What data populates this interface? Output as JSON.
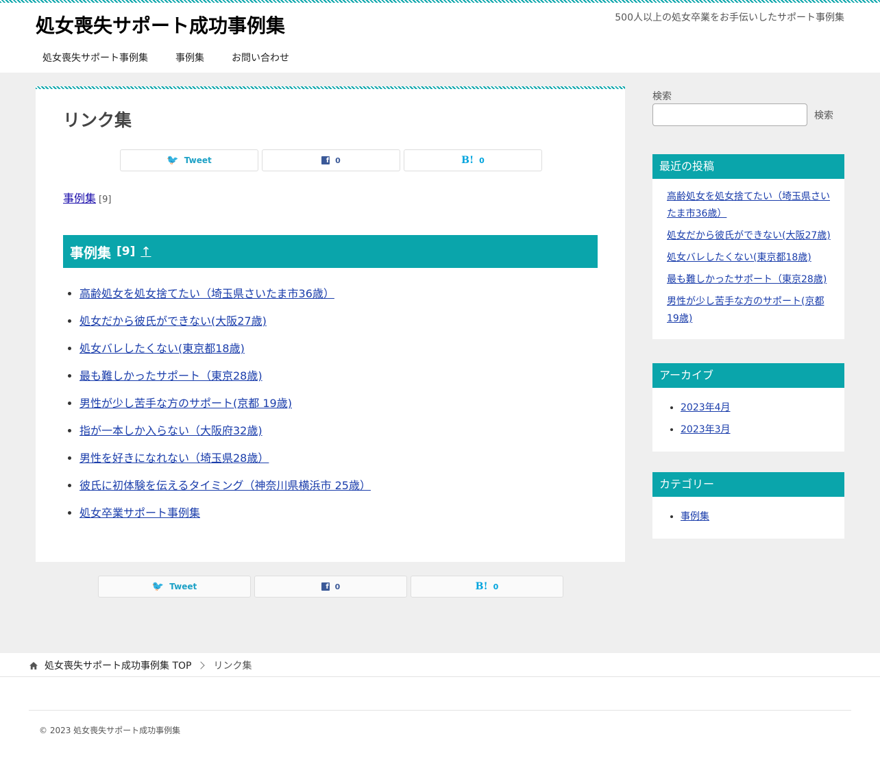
{
  "header": {
    "site_title": "処女喪失サポート成功事例集",
    "site_description": "500人以上の処女卒業をお手伝いしたサポート事例集",
    "nav": [
      "処女喪失サポート事例集",
      "事例集",
      "お問い合わせ"
    ]
  },
  "main": {
    "title": "リンク集",
    "share": {
      "tweet_label": "Tweet",
      "facebook_count": "0",
      "hatena_label": "B!",
      "hatena_count": "0"
    },
    "category_link": "事例集",
    "category_count": "[9]",
    "section": {
      "title": "事例集",
      "count": "[9]",
      "up_link": "↑"
    },
    "links": [
      "高齢処女を処女捨てたい（埼玉県さいたま市36歳）",
      "処女だから彼氏ができない(大阪27歳)",
      "処女バレしたくない(東京都18歳)",
      "最も難しかったサポート（東京28歳)",
      "男性が少し苦手な方のサポート(京都 19歳)",
      "指が一本しか入らない（大阪府32歳)",
      "男性を好きになれない（埼玉県28歳）",
      "彼氏に初体験を伝えるタイミング（神奈川県横浜市 25歳）",
      "処女卒業サポート事例集"
    ]
  },
  "sidebar": {
    "search": {
      "label": "検索",
      "value": "",
      "button_label": "検索"
    },
    "recent_posts": {
      "title": "最近の投稿",
      "items": [
        "高齢処女を処女捨てたい（埼玉県さいたま市36歳）",
        "処女だから彼氏ができない(大阪27歳)",
        "処女バレしたくない(東京都18歳)",
        "最も難しかったサポート（東京28歳)",
        "男性が少し苦手な方のサポート(京都 19歳)"
      ]
    },
    "archives": {
      "title": "アーカイブ",
      "items": [
        "2023年4月",
        "2023年3月"
      ]
    },
    "categories": {
      "title": "カテゴリー",
      "items": [
        "事例集"
      ]
    }
  },
  "breadcrumb": {
    "home": "処女喪失サポート成功事例集 TOP",
    "current": "リンク集"
  },
  "footer": {
    "copyright": "© 2023 処女喪失サポート成功事例集"
  },
  "colors": {
    "accent": "#0aa5ab",
    "link": "#1a3dab",
    "background": "#efefef"
  }
}
